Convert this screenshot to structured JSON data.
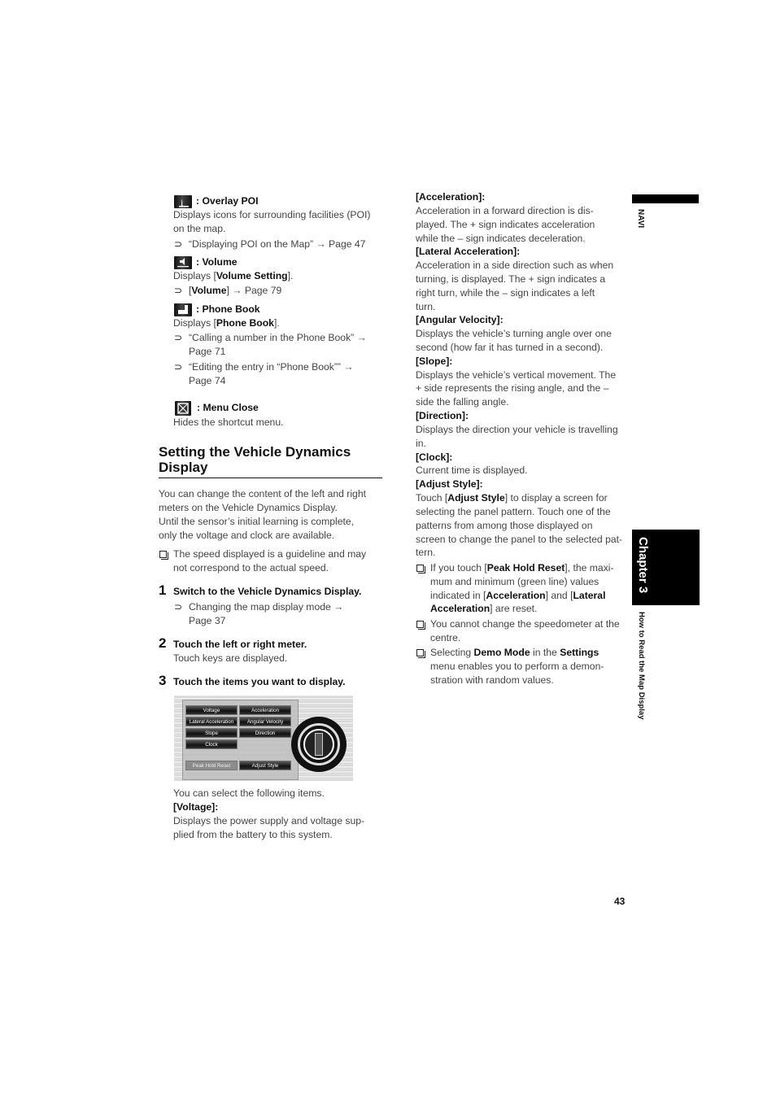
{
  "left_column": {
    "icons": [
      {
        "icon": "overlay-poi-icon",
        "label": ": Overlay POI",
        "desc": [
          "Displays icons for surrounding facilities (POI)",
          "on the map."
        ],
        "refs": [
          [
            "“Displaying POI on the Map” → Page 47"
          ]
        ]
      },
      {
        "icon": "volume-icon",
        "label": ": Volume",
        "desc_pre": "Displays [",
        "desc_bold": "Volume Setting",
        "desc_post": "].",
        "ref_pre": "[",
        "ref_bold": "Volume",
        "ref_post": "] → Page 79"
      },
      {
        "icon": "phone-book-icon",
        "label": ": Phone Book",
        "desc_pre": "Displays [",
        "desc_bold": "Phone Book",
        "desc_post": "].",
        "refs": [
          [
            "“Calling a number in the Phone Book” →",
            "Page 71"
          ],
          [
            "“Editing the entry in “Phone Book”” →",
            "Page 74"
          ]
        ]
      },
      {
        "icon": "menu-close-icon",
        "label": ": Menu Close",
        "desc": [
          "Hides the shortcut menu."
        ]
      }
    ],
    "section_title": [
      "Setting the Vehicle Dynamics",
      "Display"
    ],
    "intro": [
      "You can change the content of the left and right",
      "meters on the Vehicle Dynamics Display.",
      "Until the sensor’s initial learning is complete,",
      "only the voltage and clock are available."
    ],
    "note": [
      "The speed displayed is a guideline and may",
      "not correspond to the actual speed."
    ],
    "steps": [
      {
        "num": "1",
        "title": "Switch to the Vehicle Dynamics Display.",
        "ref": [
          "Changing the map display mode →",
          "Page 37"
        ]
      },
      {
        "num": "2",
        "title": "Touch the left or right meter.",
        "desc": "Touch keys are displayed."
      },
      {
        "num": "3",
        "title": "Touch the items you want to display."
      }
    ],
    "screen_buttons": [
      "Voltage",
      "Acceleration",
      "Lateral Acceleration",
      "Angular Velocity",
      "Slope",
      "Direction",
      "Clock",
      "Peak Hold Reset",
      "Adjust Style"
    ],
    "after_shot": "You can select the following items.",
    "voltage_head": "[Voltage]:",
    "voltage_desc": [
      "Displays the power supply and voltage sup-",
      "plied from the battery to this system."
    ]
  },
  "right_column": {
    "items": [
      {
        "head": "[Acceleration]:",
        "lines": [
          "Acceleration in a forward direction is dis-",
          "played. The + sign indicates acceleration",
          "while the – sign indicates deceleration."
        ]
      },
      {
        "head": "[Lateral Acceleration]:",
        "lines": [
          "Acceleration in a side direction such as when",
          "turning, is displayed. The + sign indicates a",
          "right turn, while the – sign indicates a left",
          "turn."
        ]
      },
      {
        "head": "[Angular Velocity]:",
        "lines": [
          "Displays the vehicle’s turning angle over one",
          "second (how far it has turned in a second)."
        ]
      },
      {
        "head": "[Slope]:",
        "lines": [
          "Displays the vehicle’s vertical movement. The",
          "+ side represents the rising angle, and the –",
          "side the falling angle."
        ]
      },
      {
        "head": "[Direction]:",
        "lines": [
          "Displays the direction your vehicle is travelling",
          "in."
        ]
      },
      {
        "head": "[Clock]:",
        "lines": [
          "Current time is displayed."
        ]
      },
      {
        "head": "[Adjust Style]:",
        "lines": [
          "",
          "selecting the panel pattern. Touch one of the",
          "patterns from among those displayed on",
          "screen to change the panel to the selected pat-",
          "tern."
        ]
      }
    ],
    "adjust_line1": {
      "pre": "Touch [",
      "bold": "Adjust Style",
      "post": "] to display a screen for"
    },
    "notes": {
      "n1": {
        "l1_pre": "If you touch [",
        "l1_bold": "Peak Hold Reset",
        "l1_post": "], the maxi-",
        "l2": "mum and minimum (green line) values",
        "l3_pre": "indicated in [",
        "l3_b1": "Acceleration",
        "l3_mid": "] and [",
        "l3_b2": "Lateral",
        "l4_b": "Acceleration",
        "l4_post": "] are reset."
      },
      "n2": [
        "You cannot change the speedometer at the",
        "centre."
      ],
      "n3": {
        "l1_pre": "Selecting ",
        "l1_b1": "Demo Mode",
        "l1_mid": " in the ",
        "l1_b2": "Settings",
        "l2": "menu enables you to perform a demon-",
        "l3": "stration with random values."
      }
    }
  },
  "sidebar": {
    "navi": "NAVI",
    "chapter": "Chapter 3",
    "section": "How to Read the Map Display"
  },
  "page_number": "43"
}
